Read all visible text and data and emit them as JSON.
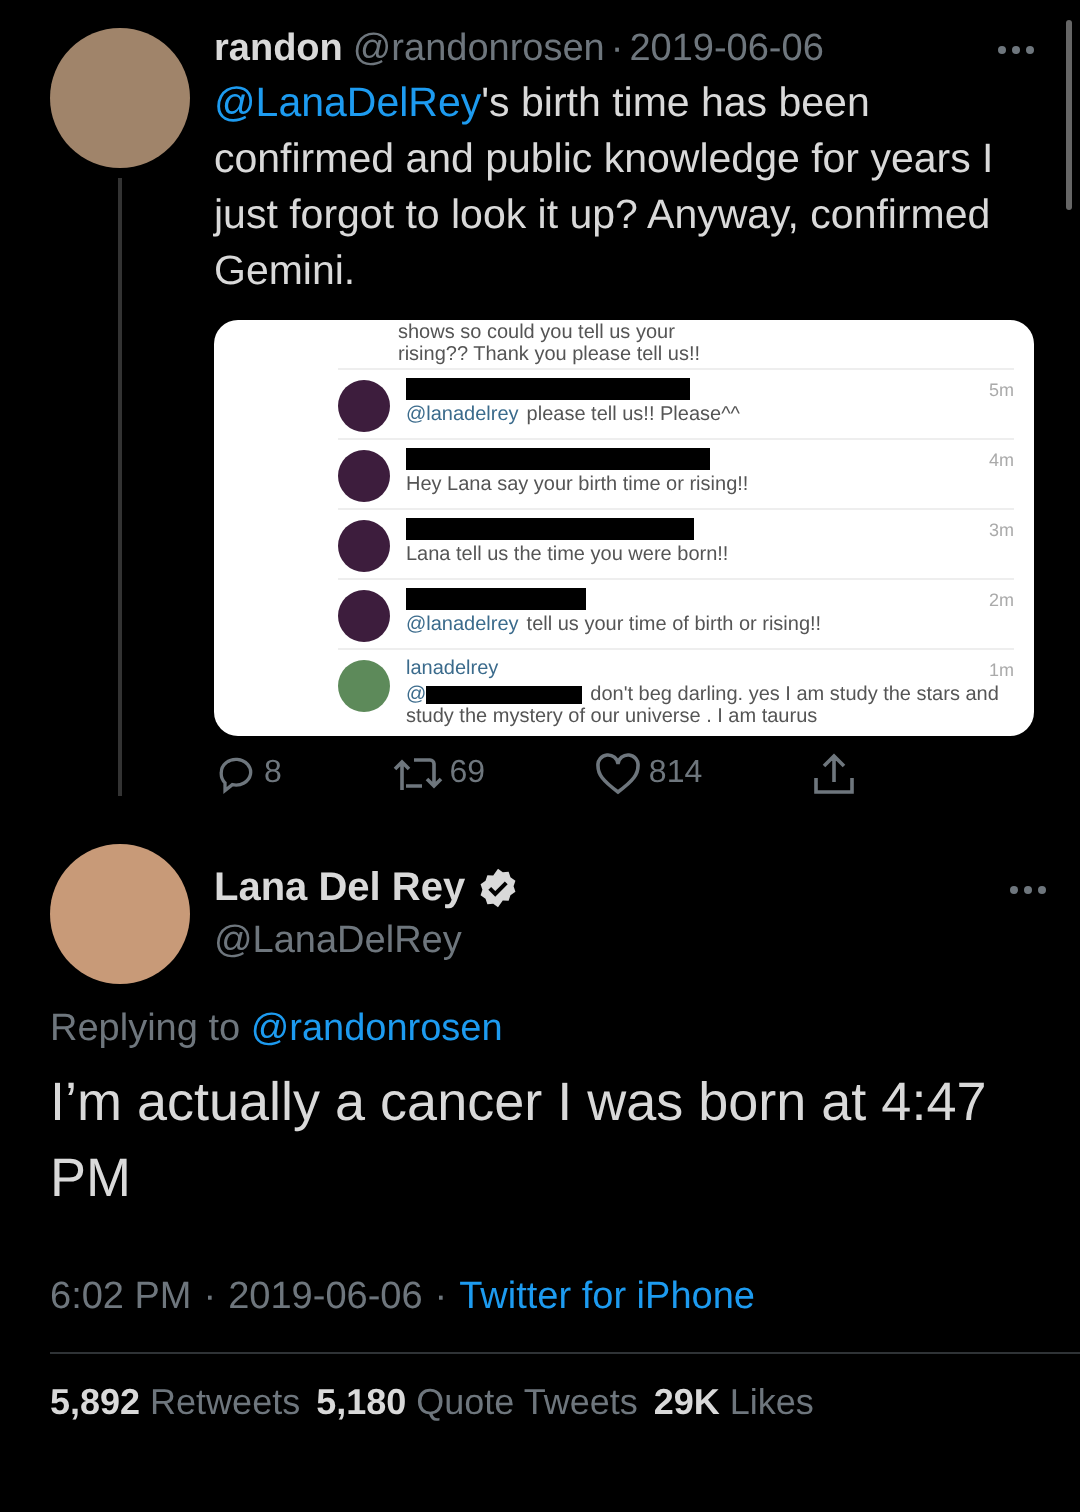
{
  "thread_tweet": {
    "name": "randon",
    "handle": "@randonrosen",
    "separator": "·",
    "date": "2019-06-06",
    "mention": "@LanaDelRey",
    "text": "'s birth time has been confirmed and public knowledge for years I just forgot to look it up? Anyway, confirmed Gemini.",
    "embedded_screenshot": {
      "top_lines": [
        "shows so could you tell us your",
        "rising?? Thank you please tell us!!"
      ],
      "comments": [
        {
          "kind": "redacted",
          "time": "5m",
          "mention": "@lanadelrey",
          "text": "please tell us!! Please^^"
        },
        {
          "kind": "redacted",
          "time": "4m",
          "text": "Hey Lana say your birth time or rising!!"
        },
        {
          "kind": "redacted",
          "time": "3m",
          "text": "Lana tell us the time you were born!!"
        },
        {
          "kind": "redacted",
          "time": "2m",
          "mention": "@lanadelrey",
          "text": "tell us your time of birth or rising!!"
        },
        {
          "kind": "named",
          "username": "lanadelrey",
          "time": "1m",
          "mention": "@",
          "redacted_mention": true,
          "text": "don't beg darling. yes I am study the stars  and study the mystery of our universe . I am taurus"
        }
      ]
    },
    "actions": [
      {
        "kind": "reply",
        "count": "8"
      },
      {
        "kind": "retweet",
        "count": "69"
      },
      {
        "kind": "like",
        "count": "814"
      },
      {
        "kind": "share"
      }
    ]
  },
  "main_tweet": {
    "name": "Lana Del Rey",
    "verified": true,
    "handle": "@LanaDelRey",
    "replying_label": "Replying to",
    "replying_to": "@randonrosen",
    "text": "I’m actually a cancer I was born at 4:47 PM",
    "time": "6:02 PM",
    "date": "2019-06-06",
    "source": "Twitter for iPhone",
    "separator": "·"
  },
  "stats": [
    "**5,892** Retweets",
    "**5,180** Quote Tweets",
    "**29K** Likes"
  ]
}
